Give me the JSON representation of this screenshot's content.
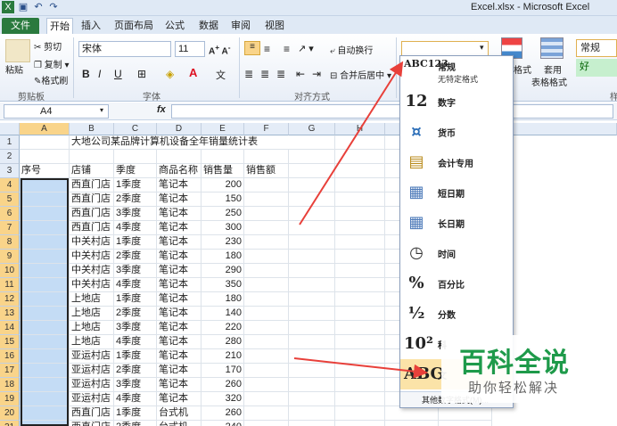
{
  "window": {
    "title": "Excel.xlsx - Microsoft Excel"
  },
  "tabs": [
    {
      "label": "文件"
    },
    {
      "label": "开始"
    },
    {
      "label": "插入"
    },
    {
      "label": "页面布局"
    },
    {
      "label": "公式"
    },
    {
      "label": "数据"
    },
    {
      "label": "审阅"
    },
    {
      "label": "视图"
    }
  ],
  "ribbon": {
    "clipboard": {
      "paste": "粘贴",
      "cut": "剪切",
      "copy": "复制",
      "format_painter": "格式刷",
      "group": "剪贴板"
    },
    "font": {
      "name": "宋体",
      "size": "11",
      "group": "字体"
    },
    "alignment": {
      "wrap": "自动换行",
      "merge": "合并后居中",
      "group": "对齐方式"
    },
    "number": {
      "format_value": ""
    },
    "styles": {
      "cond_format": "格式",
      "table_format": "套用",
      "table_format2": "表格格式",
      "normal": "常规",
      "good": "好",
      "group_partial": "样"
    }
  },
  "formula_bar": {
    "cell_ref": "A4",
    "fx": "fx",
    "content": ""
  },
  "columns": [
    "A",
    "B",
    "C",
    "D",
    "E",
    "F",
    "G",
    "H",
    "L",
    "M"
  ],
  "rows": [
    "1",
    "2",
    "3",
    "4",
    "5",
    "6",
    "7",
    "8",
    "9",
    "10",
    "11",
    "12",
    "13",
    "14",
    "15",
    "16",
    "17",
    "18",
    "19",
    "20",
    "21"
  ],
  "sheet": {
    "title": "大地公司某品牌计算机设备全年销量统计表",
    "headers": [
      "序号",
      "店铺",
      "季度",
      "商品名称",
      "销售量",
      "销售额"
    ],
    "data": [
      [
        "西直门店",
        "1季度",
        "笔记本",
        "200"
      ],
      [
        "西直门店",
        "2季度",
        "笔记本",
        "150"
      ],
      [
        "西直门店",
        "3季度",
        "笔记本",
        "250"
      ],
      [
        "西直门店",
        "4季度",
        "笔记本",
        "300"
      ],
      [
        "中关村店",
        "1季度",
        "笔记本",
        "230"
      ],
      [
        "中关村店",
        "2季度",
        "笔记本",
        "180"
      ],
      [
        "中关村店",
        "3季度",
        "笔记本",
        "290"
      ],
      [
        "中关村店",
        "4季度",
        "笔记本",
        "350"
      ],
      [
        "上地店",
        "1季度",
        "笔记本",
        "180"
      ],
      [
        "上地店",
        "2季度",
        "笔记本",
        "140"
      ],
      [
        "上地店",
        "3季度",
        "笔记本",
        "220"
      ],
      [
        "上地店",
        "4季度",
        "笔记本",
        "280"
      ],
      [
        "亚运村店",
        "1季度",
        "笔记本",
        "210"
      ],
      [
        "亚运村店",
        "2季度",
        "笔记本",
        "170"
      ],
      [
        "亚运村店",
        "3季度",
        "笔记本",
        "260"
      ],
      [
        "亚运村店",
        "4季度",
        "笔记本",
        "320"
      ],
      [
        "西直门店",
        "1季度",
        "台式机",
        "260"
      ],
      [
        "西直门店",
        "2季度",
        "台式机",
        "240"
      ]
    ]
  },
  "number_format_menu": {
    "items": [
      {
        "icon": "ABC123",
        "label": "常规",
        "sub": "无特定格式"
      },
      {
        "icon": "12",
        "label": "数字"
      },
      {
        "icon": "¤",
        "label": "货币"
      },
      {
        "icon": "▤",
        "label": "会计专用"
      },
      {
        "icon": "▦",
        "label": "短日期"
      },
      {
        "icon": "▦",
        "label": "长日期"
      },
      {
        "icon": "◷",
        "label": "时间"
      },
      {
        "icon": "%",
        "label": "百分比"
      },
      {
        "icon": "½",
        "label": "分数"
      },
      {
        "icon": "10²",
        "label": "科"
      },
      {
        "icon": "ABC",
        "label": "文"
      }
    ],
    "footer": "其他数字格式(M)..."
  },
  "watermark": {
    "main": "百科全说",
    "sub": "助你轻松解决"
  },
  "colors": {
    "file_tab": "#2a7a3e",
    "selection": "#c4dcf5",
    "highlight": "#fbe3a8",
    "arrow": "#e8403a",
    "watermark": "#1e9a4a"
  }
}
